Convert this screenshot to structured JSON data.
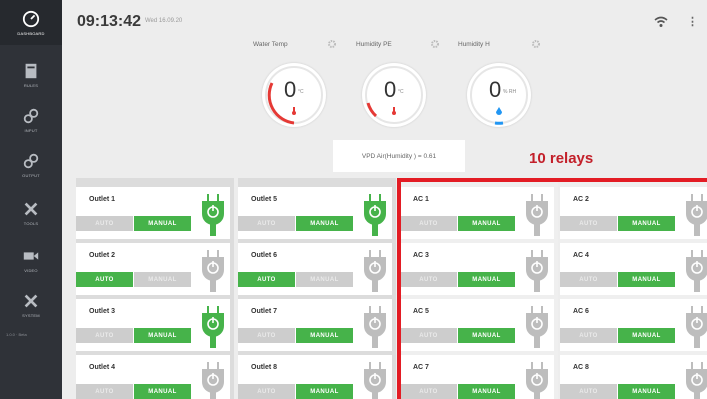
{
  "sidebar": {
    "items": [
      {
        "label": "DASHBOARD",
        "icon": "dashboard-icon"
      },
      {
        "label": "RULES",
        "icon": "rules-icon"
      },
      {
        "label": "INPUT",
        "icon": "input-icon"
      },
      {
        "label": "OUTPUT",
        "icon": "output-icon"
      },
      {
        "label": "TOOLS",
        "icon": "tools-icon"
      },
      {
        "label": "VIDEO",
        "icon": "video-icon"
      },
      {
        "label": "SYSTEM",
        "icon": "system-icon"
      }
    ],
    "version": "1.0.0 · Beta"
  },
  "header": {
    "clock": "09:13:42",
    "date": "Wed 16.09.20"
  },
  "gauges": [
    {
      "label": "Water Temp",
      "value": "0",
      "unit": "°C",
      "color": "#e53935"
    },
    {
      "label": "Humidity PE",
      "value": "0",
      "unit": "°C",
      "color": "#e53935"
    },
    {
      "label": "Humidity H",
      "value": "0",
      "unit": "% RH",
      "color": "#2196f3"
    }
  ],
  "vpd": "VPD Air(Humidity ) = 0.61",
  "annotation": "10 relays",
  "buttons": {
    "auto": "AUTO",
    "manual": "MANUAL"
  },
  "colors": {
    "active": "#46b34a",
    "inactive": "#cdcdcd",
    "highlight": "#e31c24"
  },
  "columns": [
    {
      "relays": [
        {
          "name": "Outlet 1",
          "mode": "manual",
          "power": "on"
        },
        {
          "name": "Outlet 2",
          "mode": "auto",
          "power": "off"
        },
        {
          "name": "Outlet 3",
          "mode": "manual",
          "power": "on"
        },
        {
          "name": "Outlet 4",
          "mode": "manual",
          "power": "off"
        }
      ]
    },
    {
      "relays": [
        {
          "name": "Outlet 5",
          "mode": "manual",
          "power": "on"
        },
        {
          "name": "Outlet 6",
          "mode": "auto",
          "power": "off"
        },
        {
          "name": "Outlet 7",
          "mode": "manual",
          "power": "off"
        },
        {
          "name": "Outlet 8",
          "mode": "manual",
          "power": "off"
        }
      ]
    },
    {
      "relays": [
        {
          "name": "AC 1",
          "mode": "manual",
          "power": "off"
        },
        {
          "name": "AC 3",
          "mode": "manual",
          "power": "off"
        },
        {
          "name": "AC 5",
          "mode": "manual",
          "power": "off"
        },
        {
          "name": "AC 7",
          "mode": "manual",
          "power": "off"
        }
      ]
    },
    {
      "relays": [
        {
          "name": "AC 2",
          "mode": "manual",
          "power": "off"
        },
        {
          "name": "AC 4",
          "mode": "manual",
          "power": "off"
        },
        {
          "name": "AC 6",
          "mode": "manual",
          "power": "off"
        },
        {
          "name": "AC 8",
          "mode": "manual",
          "power": "off"
        }
      ]
    }
  ]
}
